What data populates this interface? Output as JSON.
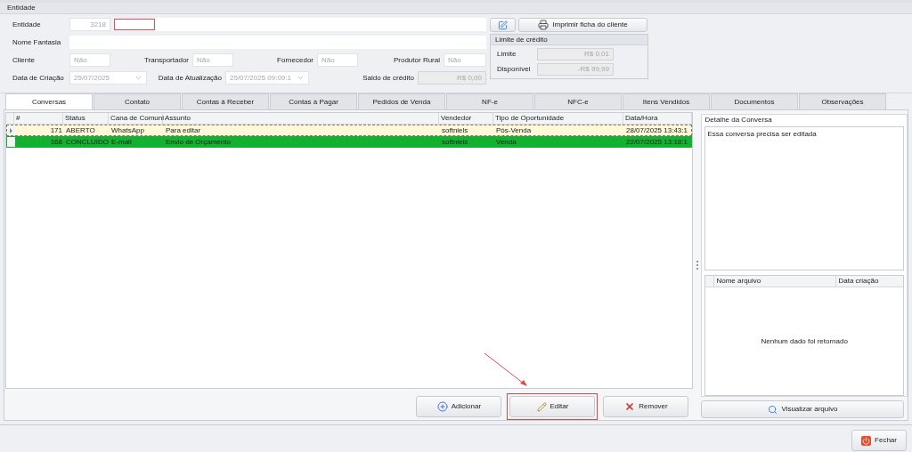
{
  "entity_group": {
    "title": "Entidade"
  },
  "entidade": {
    "label": "Entidade",
    "code": "3218",
    "invalid": true
  },
  "nome_fantasia": {
    "label": "Nome Fantasia"
  },
  "flags": [
    {
      "label": "Cliente",
      "value": "Não"
    },
    {
      "label": "Transportador",
      "value": "Não"
    },
    {
      "label": "Fornecedor",
      "value": "Não"
    },
    {
      "label": "Produtor Rural",
      "value": "Não"
    }
  ],
  "dates": [
    {
      "label": "Data de Criação",
      "value": "25/07/2025"
    },
    {
      "label": "Data de Atualização",
      "value": "25/07/2025 09:09:1"
    }
  ],
  "saldo": {
    "label": "Saldo de crédito",
    "value": "R$ 0,00"
  },
  "print_button": "Imprimir ficha do cliente",
  "credit_limit": {
    "title": "Limite de crédito",
    "rows": [
      {
        "label": "Limite",
        "value": "R$ 0,01"
      },
      {
        "label": "Disponível",
        "value": "-R$ 99,99"
      }
    ]
  },
  "tabs": [
    {
      "label": "Conversas",
      "selected": true
    },
    {
      "label": "Contato",
      "selected": false
    },
    {
      "label": "Contas à Receber",
      "selected": false
    },
    {
      "label": "Contas à Pagar",
      "selected": false
    },
    {
      "label": "Pedidos de Venda",
      "selected": false
    },
    {
      "label": "NF-e",
      "selected": false
    },
    {
      "label": "NFC-e",
      "selected": false
    },
    {
      "label": "Itens Vendidos",
      "selected": false
    },
    {
      "label": "Documentos",
      "selected": false
    },
    {
      "label": "Observações",
      "selected": false
    }
  ],
  "grid": {
    "columns": [
      "#",
      "Status",
      "Cana de Comuni",
      "Assunto",
      "Vendedor",
      "Tipo de Oportunidade",
      "Data/Hora"
    ],
    "rows": [
      {
        "selected": true,
        "color": "#fff8d8",
        "cells": [
          "171",
          "ABERTO",
          "WhatsApp",
          "Para editar",
          "softniels",
          "Pós-Venda",
          "28/07/2025 13:43:1"
        ]
      },
      {
        "selected": false,
        "color": "#12b12f",
        "cells": [
          "168",
          "CONCLUIDO",
          "E-mail",
          "Envio de Orçamento",
          "softniels",
          "Venda",
          "22/07/2025 13:18:1"
        ]
      }
    ]
  },
  "actions": [
    {
      "kind": "add",
      "label": "Adicionar",
      "highlighted": false
    },
    {
      "kind": "edit",
      "label": "Editar",
      "highlighted": true
    },
    {
      "kind": "remove",
      "label": "Remover",
      "highlighted": false
    }
  ],
  "detail": {
    "title": "Detalhe da Conversa",
    "text": "Essa conversa precisa ser editada"
  },
  "files": {
    "columns": [
      "Nome arquivo",
      "Data criação"
    ],
    "empty_message": "Nenhum dado foi retornado"
  },
  "view_button": "Visualizar arquivo",
  "close_button": "Fechar"
}
